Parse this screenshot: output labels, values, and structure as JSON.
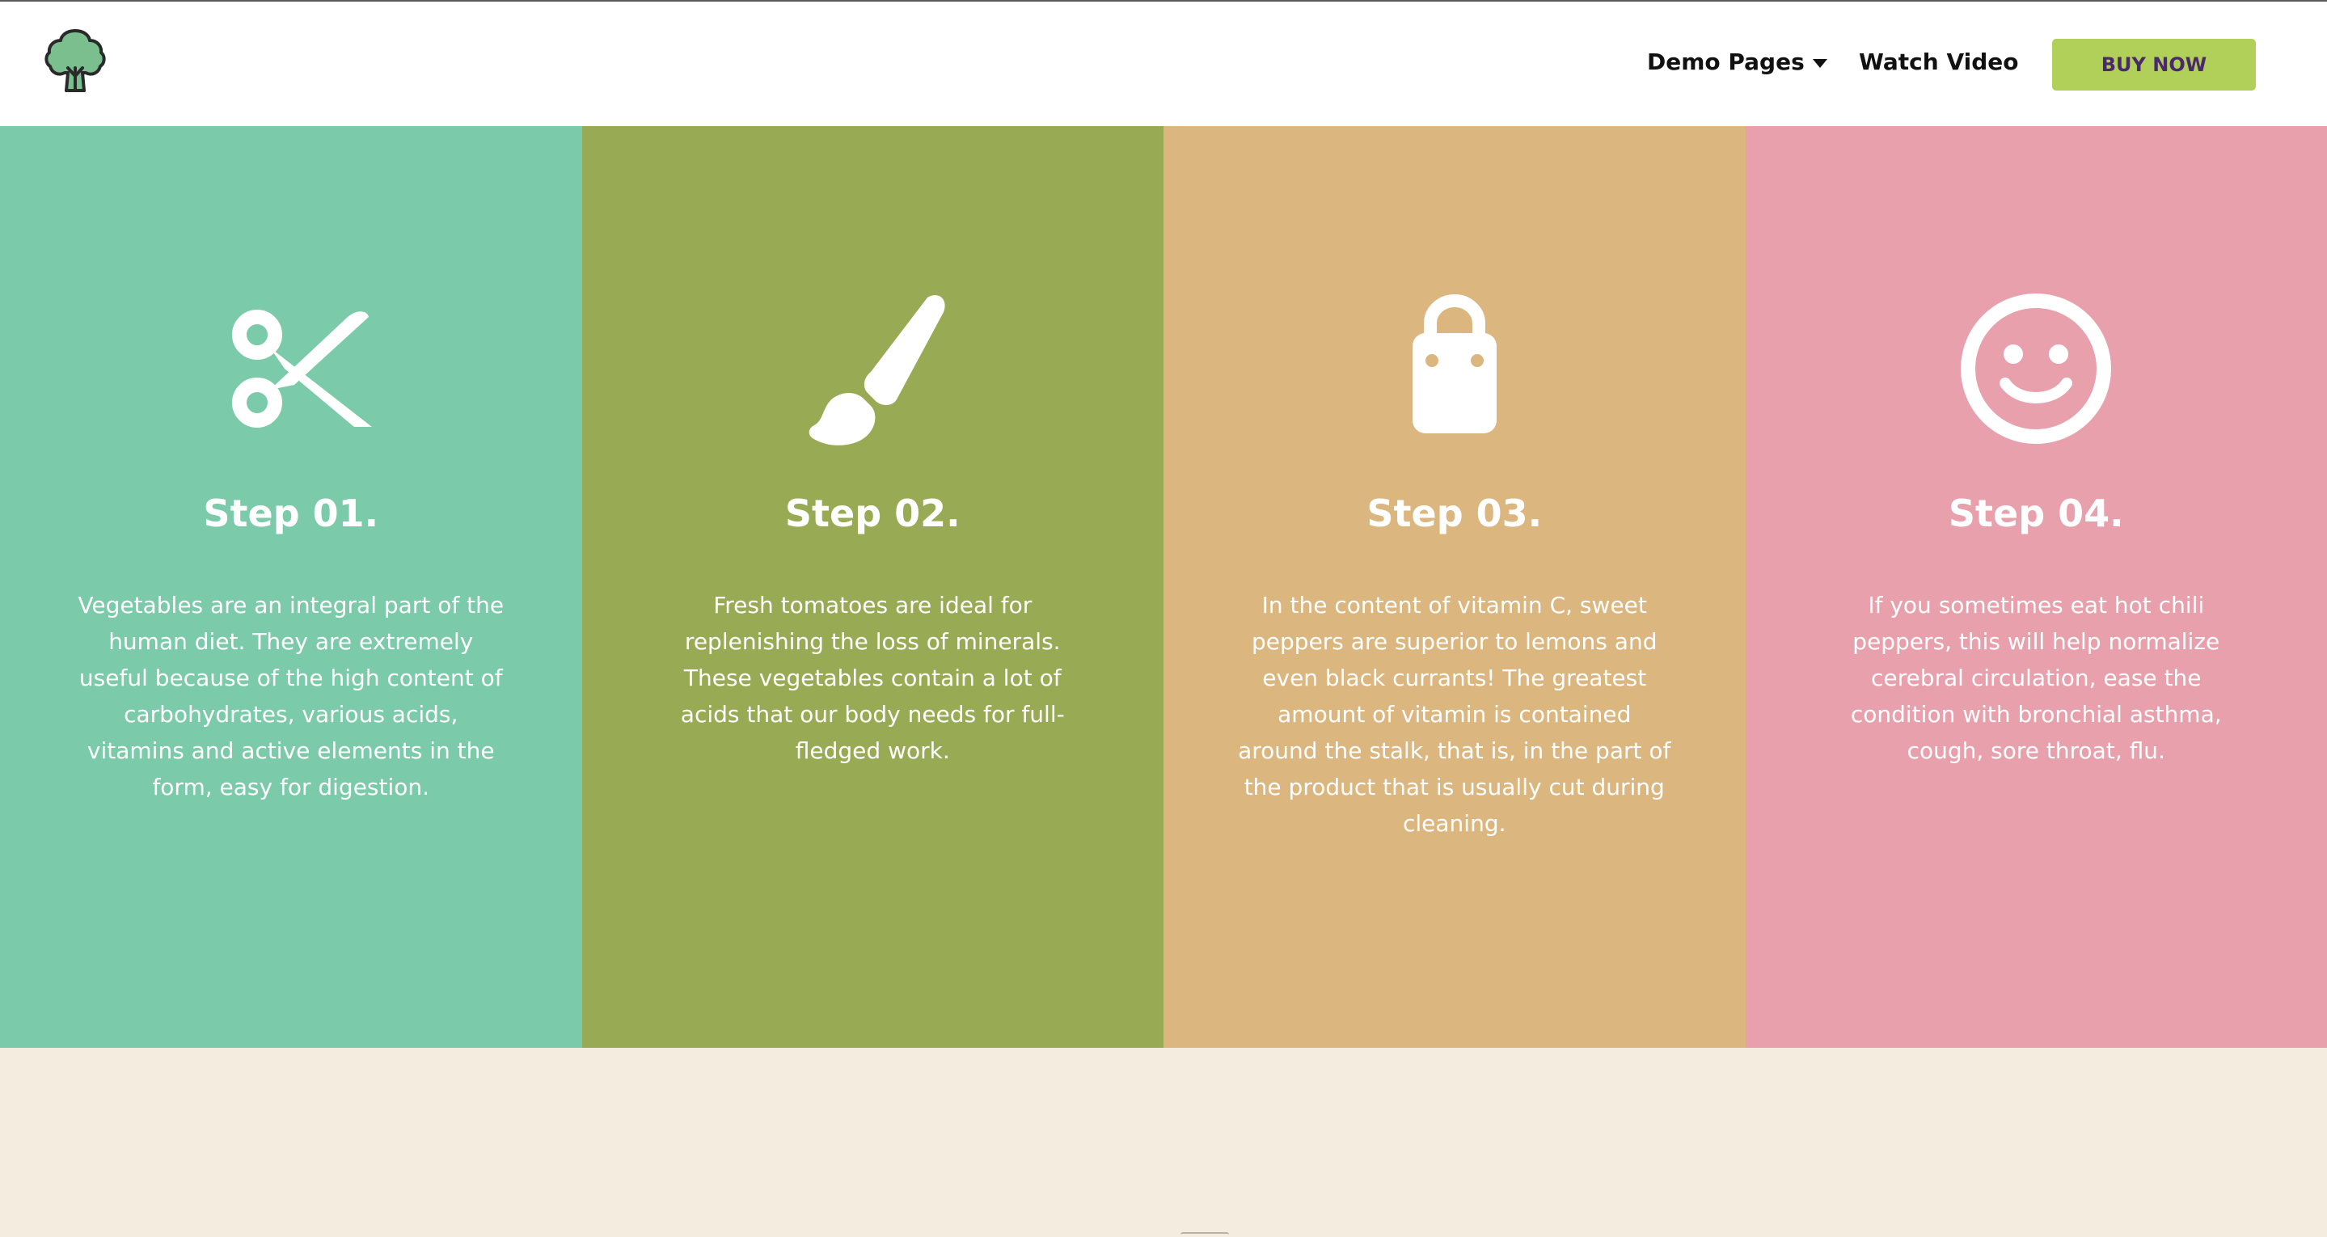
{
  "header": {
    "logo_icon": "broccoli-logo-icon",
    "nav": {
      "demo_pages": "Demo Pages",
      "watch_video": "Watch Video",
      "buy_now": "BUY NOW"
    }
  },
  "colors": {
    "step1": "#7bcaa9",
    "step2": "#98ab54",
    "step3": "#dbb67f",
    "step4": "#e8a1ac",
    "buy_button": "#b0d05a",
    "lower_section": "#f5ece0"
  },
  "steps": [
    {
      "icon": "scissors-icon",
      "title": "Step 01.",
      "text": "Vegetables are an integral part of the human diet. They are extremely useful because of the high content of carbohydrates, various acids, vitamins and active elements in the form, easy for digestion."
    },
    {
      "icon": "paint-brush-icon",
      "title": "Step 02.",
      "text": "Fresh tomatoes are ideal for replenishing the loss of minerals. These vegetables contain a lot of acids that our body needs for full-fledged work."
    },
    {
      "icon": "shopping-bag-icon",
      "title": "Step 03.",
      "text": "In the content of vitamin C, sweet peppers are superior to lemons and even black currants! The greatest amount of vitamin is contained around the stalk, that is, in the part of the product that is usually cut during cleaning."
    },
    {
      "icon": "smiley-face-icon",
      "title": "Step 04.",
      "text": "If you sometimes eat hot chili peppers, this will help normalize cerebral circulation, ease the condition with bronchial asthma, cough, sore throat, flu."
    }
  ]
}
